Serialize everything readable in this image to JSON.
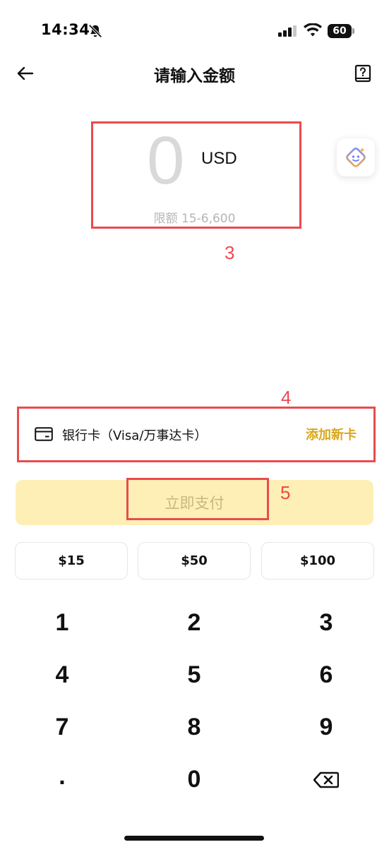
{
  "status_bar": {
    "time": "14:34",
    "battery": "60",
    "icons": [
      "bell-slash-icon",
      "signal-icon",
      "wifi-icon",
      "battery-icon"
    ]
  },
  "header": {
    "title": "请输入金额",
    "back_icon": "arrow-left-icon",
    "help_icon": "help-book-icon"
  },
  "amount": {
    "value": "0",
    "currency": "USD",
    "limit": "限额 15-6,600"
  },
  "annotations": {
    "amount_label": "3",
    "payment_label": "4",
    "pay_label": "5",
    "color": "#e94b4e"
  },
  "payment_method": {
    "label": "银行卡（Visa/万事达卡）",
    "add_card": "添加新卡",
    "accent": "#d9a61c"
  },
  "pay_button": {
    "label": "立即支付",
    "bg": "#fdefb5"
  },
  "presets": [
    "$15",
    "$50",
    "$100"
  ],
  "keypad": {
    "keys": [
      "1",
      "2",
      "3",
      "4",
      "5",
      "6",
      "7",
      "8",
      "9",
      ".",
      "0"
    ],
    "backspace_icon": "backspace-icon"
  }
}
